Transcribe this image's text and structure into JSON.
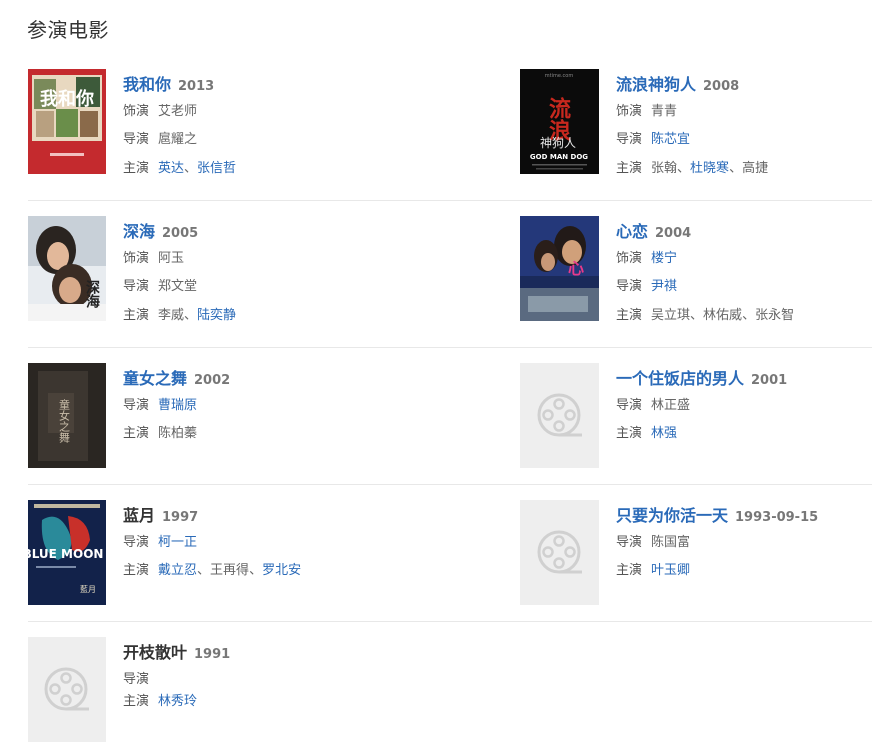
{
  "section_title": "参演电影",
  "labels": {
    "role": "饰演",
    "director": "导演",
    "cast": "主演",
    "sep": "、"
  },
  "films": [
    {
      "title": "我和你",
      "year": "2013",
      "role": "艾老师",
      "director": "扈耀之",
      "cast": [
        "英达",
        "张信哲"
      ]
    },
    {
      "title": "流浪神狗人",
      "year": "2008",
      "role": "青青",
      "director": "陈芯宜",
      "cast": [
        "张翰",
        "杜晓寒",
        "高捷"
      ]
    },
    {
      "title": "深海",
      "year": "2005",
      "role": "阿玉",
      "director": "郑文堂",
      "cast": [
        "李威",
        "陆奕静"
      ]
    },
    {
      "title": "心恋",
      "year": "2004",
      "role": "楼宁",
      "director": "尹祺",
      "cast": [
        "吴立琪",
        "林佑威",
        "张永智"
      ]
    },
    {
      "title": "童女之舞",
      "year": "2002",
      "director": "曹瑞原",
      "cast": [
        "陈柏蓁"
      ]
    },
    {
      "title": "一个住饭店的男人",
      "year": "2001",
      "director": "林正盛",
      "cast": [
        "林强"
      ]
    },
    {
      "title": "蓝月",
      "year": "1997",
      "director": "柯一正",
      "cast": [
        "戴立忍",
        "王再得",
        "罗北安"
      ]
    },
    {
      "title": "只要为你活一天",
      "year": "1993-09-15",
      "director": "陈国富",
      "cast": [
        "叶玉卿"
      ]
    },
    {
      "title": "开枝散叶",
      "year": "1991",
      "director": "",
      "cast": [
        "林秀玲"
      ]
    }
  ],
  "posters": {
    "p1_text": "我和你",
    "p2_top": "mtime.com",
    "p2_main": "流浪",
    "p2_sub": "神狗人",
    "p2_en": "GOD MAN DOG",
    "p3_text": "深海",
    "p4_text": "心",
    "p5_text": "童女之舞",
    "p7_en": "BLUE MOON",
    "p7_cn": "藍月"
  }
}
